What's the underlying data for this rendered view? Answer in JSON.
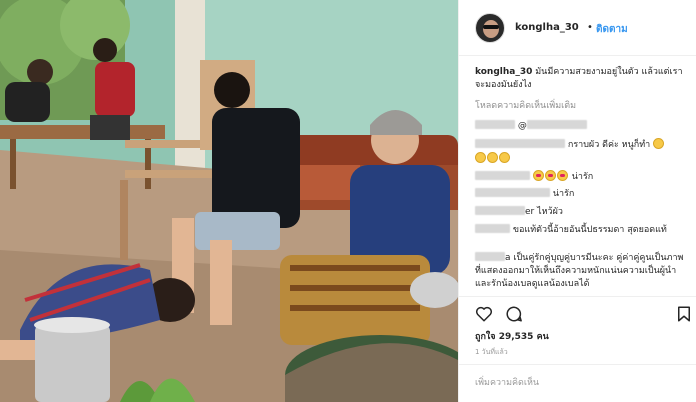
{
  "post": {
    "username": "konglha_30",
    "separator": "•",
    "follow_label": "ติดตาม",
    "caption": "มันมีความสวยงามอยู่ในตัว แล้วแต่เราจะมองมันยังไง",
    "load_more": "โหลดความคิดเห็นเพิ่มเติม"
  },
  "comments": [
    {
      "text": "@"
    },
    {
      "text": "กราบผัว ดีค่ะ หนูก็ทำ"
    },
    {
      "text": ""
    },
    {
      "text": "น่ารัก"
    },
    {
      "text": "น่ารัก"
    },
    {
      "text": "er ไหว้ผัว"
    },
    {
      "text": "ขอแท้ตัวนี้อ้ายอันนี้ปธรรมดา สุดยอดแท้"
    },
    {
      "text": "a เป็นคู่รักคู่บุญคู่บารมีนะคะ คู่ค่าคู่คูนเป็นภาพที่แสดงออกมาให้เห็นถึงความหนักแน่นความเป็นผู้นำ และรักน้องเบลดูแลน้องเบลได้"
    }
  ],
  "stats": {
    "likes_prefix": "ถูกใจ",
    "likes_count": "29,535",
    "likes_suffix": "คน",
    "time_ago": "1 วันที่แล้ว"
  },
  "composer": {
    "placeholder": "เพิ่มความคิดเห็น"
  },
  "icons": [
    "heart-icon",
    "comment-icon",
    "bookmark-icon"
  ],
  "colors": {
    "link_blue": "#3897f0",
    "muted": "#8e8e8e",
    "border": "#efefef"
  }
}
